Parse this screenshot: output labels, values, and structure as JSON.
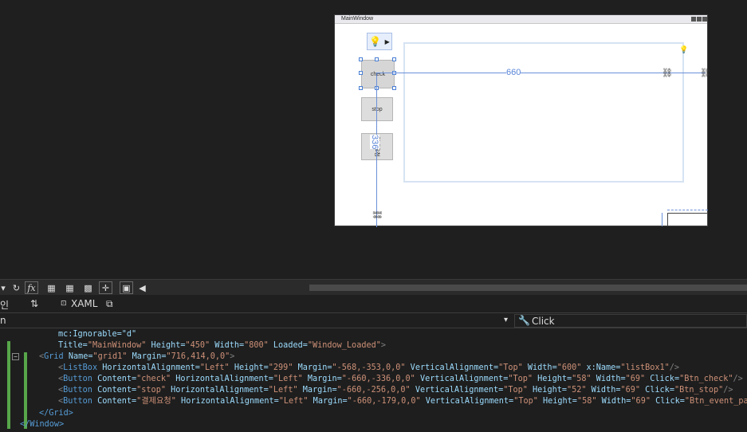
{
  "designer": {
    "window_title": "MainWindow",
    "buttons": {
      "check": "check",
      "stop": "stop",
      "event_pay": "결제요청"
    },
    "dim_width": "660",
    "dim_height": "336"
  },
  "toolbar": {
    "fx_label": "fx"
  },
  "tabs": {
    "left_label": "인",
    "swap_icon_text": "⇅",
    "xaml_label": "XAML"
  },
  "selbar": {
    "left_text": "n",
    "event_label": "Click"
  },
  "code": {
    "l1": "mc:Ignorable=\"d\"",
    "l2_title": "Title=",
    "l2_title_v": "\"MainWindow\"",
    "l2_h": " Height=",
    "l2_h_v": "\"450\"",
    "l2_w": " Width=",
    "l2_w_v": "\"800\"",
    "l2_l": " Loaded=",
    "l2_l_v": "\"Window_Loaded\"",
    "l2_end": ">",
    "l3_open": "<",
    "l3_tag": "Grid",
    "l3_name": " Name=",
    "l3_name_v": "\"grid1\"",
    "l3_margin": " Margin=",
    "l3_margin_v": "\"716,414,0,0\"",
    "l3_close": ">",
    "l4": [
      {
        "c": "t-punct",
        "t": "<"
      },
      {
        "c": "t-tag",
        "t": "ListBox"
      },
      {
        "c": "t-attr",
        "t": " HorizontalAlignment="
      },
      {
        "c": "t-str",
        "t": "\"Left\""
      },
      {
        "c": "t-attr",
        "t": " Height="
      },
      {
        "c": "t-str",
        "t": "\"299\""
      },
      {
        "c": "t-attr",
        "t": " Margin="
      },
      {
        "c": "t-str",
        "t": "\"-568,-353,0,0\""
      },
      {
        "c": "t-attr",
        "t": " VerticalAlignment="
      },
      {
        "c": "t-str",
        "t": "\"Top\""
      },
      {
        "c": "t-attr",
        "t": " Width="
      },
      {
        "c": "t-str",
        "t": "\"600\""
      },
      {
        "c": "t-attr",
        "t": " x:Name="
      },
      {
        "c": "t-str",
        "t": "\"listBox1\""
      },
      {
        "c": "t-punct",
        "t": "/>"
      }
    ],
    "l5": [
      {
        "c": "t-punct",
        "t": "<"
      },
      {
        "c": "t-tag",
        "t": "Button"
      },
      {
        "c": "t-attr",
        "t": " Content="
      },
      {
        "c": "t-str",
        "t": "\"check\""
      },
      {
        "c": "t-attr",
        "t": " HorizontalAlignment="
      },
      {
        "c": "t-str",
        "t": "\"Left\""
      },
      {
        "c": "t-attr",
        "t": " Margin="
      },
      {
        "c": "t-str",
        "t": "\"-660,-336,0,0\""
      },
      {
        "c": "t-attr",
        "t": " VerticalAlignment="
      },
      {
        "c": "t-str",
        "t": "\"Top\""
      },
      {
        "c": "t-attr",
        "t": " Height="
      },
      {
        "c": "t-str",
        "t": "\"58\""
      },
      {
        "c": "t-attr",
        "t": " Width="
      },
      {
        "c": "t-str",
        "t": "\"69\""
      },
      {
        "c": "t-attr",
        "t": " Click="
      },
      {
        "c": "t-str",
        "t": "\"Btn_check\""
      },
      {
        "c": "t-punct",
        "t": "/>"
      }
    ],
    "l6": [
      {
        "c": "t-punct",
        "t": "<"
      },
      {
        "c": "t-tag",
        "t": "Button"
      },
      {
        "c": "t-attr",
        "t": " Content="
      },
      {
        "c": "t-str",
        "t": "\"stop\""
      },
      {
        "c": "t-attr",
        "t": " HorizontalAlignment="
      },
      {
        "c": "t-str",
        "t": "\"Left\""
      },
      {
        "c": "t-attr",
        "t": " Margin="
      },
      {
        "c": "t-str",
        "t": "\"-660,-256,0,0\""
      },
      {
        "c": "t-attr",
        "t": " VerticalAlignment="
      },
      {
        "c": "t-str",
        "t": "\"Top\""
      },
      {
        "c": "t-attr",
        "t": " Height="
      },
      {
        "c": "t-str",
        "t": "\"52\""
      },
      {
        "c": "t-attr",
        "t": " Width="
      },
      {
        "c": "t-str",
        "t": "\"69\""
      },
      {
        "c": "t-attr",
        "t": " Click="
      },
      {
        "c": "t-str",
        "t": "\"Btn_stop\""
      },
      {
        "c": "t-punct",
        "t": "/>"
      }
    ],
    "l7": [
      {
        "c": "t-punct",
        "t": "<"
      },
      {
        "c": "t-tag",
        "t": "Button"
      },
      {
        "c": "t-attr",
        "t": " Content="
      },
      {
        "c": "t-str",
        "t": "\"결제요청\""
      },
      {
        "c": "t-attr",
        "t": " HorizontalAlignment="
      },
      {
        "c": "t-str",
        "t": "\"Left\""
      },
      {
        "c": "t-attr",
        "t": " Margin="
      },
      {
        "c": "t-str",
        "t": "\"-660,-179,0,0\""
      },
      {
        "c": "t-attr",
        "t": " VerticalAlignment="
      },
      {
        "c": "t-str",
        "t": "\"Top\""
      },
      {
        "c": "t-attr",
        "t": " Height="
      },
      {
        "c": "t-str",
        "t": "\"58\""
      },
      {
        "c": "t-attr",
        "t": " Width="
      },
      {
        "c": "t-str",
        "t": "\"69\""
      },
      {
        "c": "t-attr",
        "t": " Click="
      },
      {
        "c": "t-str",
        "t": "\"Btn_event_pay\""
      },
      {
        "c": "t-punct",
        "t": "/>"
      }
    ],
    "l8": "</Grid>",
    "l9": "</Window>"
  }
}
